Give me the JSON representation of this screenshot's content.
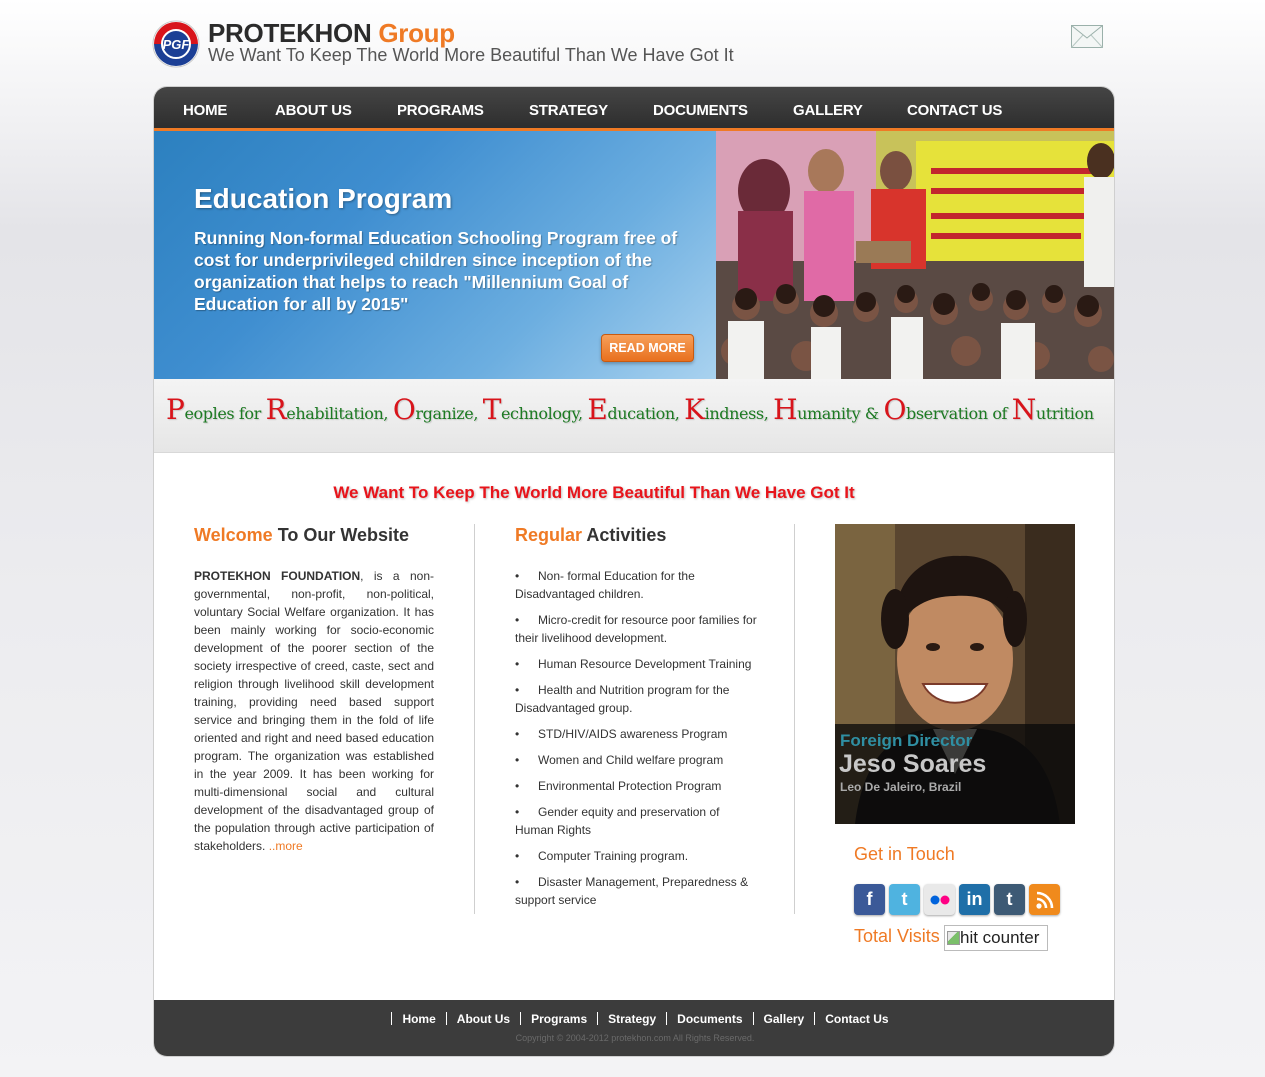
{
  "header": {
    "brand_name": "PROTEKHON",
    "brand_group": "Group",
    "tagline": "We Want To Keep The World More Beautiful Than We Have Got It",
    "logo_text": "PGF"
  },
  "nav": {
    "items": [
      "HOME",
      "ABOUT US",
      "PROGRAMS",
      "STRATEGY",
      "DOCUMENTS",
      "GALLERY",
      "CONTACT US"
    ]
  },
  "banner": {
    "title": "Education Program",
    "text": "Running Non-formal Education Schooling Program free of cost for underprivileged children since inception of the organization that helps to reach \"Millennium Goal of Education for all by 2015\"",
    "read_more": "READ MORE"
  },
  "acronym": [
    {
      "cap": "P",
      "rest": "eoples for "
    },
    {
      "cap": "R",
      "rest": "ehabilitation, "
    },
    {
      "cap": "O",
      "rest": "rganize, "
    },
    {
      "cap": "T",
      "rest": "echnology, "
    },
    {
      "cap": "E",
      "rest": "ducation, "
    },
    {
      "cap": "K",
      "rest": "indness, "
    },
    {
      "cap": "H",
      "rest": "umanity & "
    },
    {
      "cap": "O",
      "rest": "bservation of "
    },
    {
      "cap": "N",
      "rest": "utrition"
    }
  ],
  "slogan": "We Want To Keep The World More Beautiful Than We Have Got It",
  "welcome": {
    "heading_hl": "Welcome",
    "heading_rest": " To Our Website",
    "org_name": "PROTEKHON FOUNDATION",
    "body": ", is a non-governmental, non-profit, non-political, voluntary Social Welfare organization. It has been mainly working for socio-economic development of the poorer section of the society irrespective of creed, caste, sect and religion through livelihood skill development training, providing need based support service and bringing them in the fold of life oriented and right and need based education program. The organization was established in the year 2009. It has been working for multi-dimensional social and cultural development of the disadvantaged group of the population through active participation of stakeholders. ",
    "more": "..more"
  },
  "activities": {
    "heading_hl": "Regular",
    "heading_rest": " Activities",
    "items": [
      "Non- formal Education for the Disadvantaged children.",
      "Micro-credit for resource poor families for their livelihood development.",
      "Human Resource Development Training",
      "Health and Nutrition program for the Disadvantaged group.",
      "STD/HIV/AIDS awareness Program",
      "Women and Child welfare program",
      "Environmental Protection Program",
      "Gender equity and preservation of Human Rights",
      "Computer Training program.",
      "Disaster Management, Preparedness & support service"
    ]
  },
  "director": {
    "role": "Foreign Director",
    "name": "Jeso Soares",
    "location": "Leo De Jaleiro, Brazil"
  },
  "sidebar": {
    "get_in_touch": "Get in Touch",
    "social": [
      {
        "name": "facebook-icon",
        "glyph": "f",
        "color": "#3b5998"
      },
      {
        "name": "twitter-icon",
        "glyph": "t",
        "color": "#4fb3e0"
      },
      {
        "name": "flickr-icon",
        "glyph": "••",
        "color": "#e6e6e6"
      },
      {
        "name": "linkedin-icon",
        "glyph": "in",
        "color": "#1f6fa8"
      },
      {
        "name": "tumblr-icon",
        "glyph": "t",
        "color": "#3d5a75"
      },
      {
        "name": "rss-icon",
        "glyph": "))",
        "color": "#f08a1c"
      }
    ],
    "total_visits": "Total Visits",
    "counter_alt": "hit counter"
  },
  "footer": {
    "links": [
      "Home",
      "About Us",
      "Programs",
      "Strategy",
      "Documents",
      "Gallery",
      "Contact Us"
    ],
    "copyright": "Copyright © 2004-2012 protekhon.com All Rights Reserved."
  },
  "colors": {
    "accent": "#ef7a25",
    "nav_bg": "#333333",
    "acronym_cap": "#d8141b",
    "acronym_text": "#1d7a23",
    "slogan": "#e8141b"
  }
}
